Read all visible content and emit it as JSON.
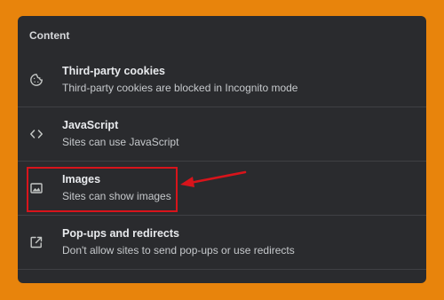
{
  "section": {
    "title": "Content"
  },
  "rows": [
    {
      "icon": "cookie-icon",
      "title": "Third-party cookies",
      "description": "Third-party cookies are blocked in Incognito mode"
    },
    {
      "icon": "code-icon",
      "title": "JavaScript",
      "description": "Sites can use JavaScript"
    },
    {
      "icon": "image-icon",
      "title": "Images",
      "description": "Sites can show images"
    },
    {
      "icon": "open-in-new-icon",
      "title": "Pop-ups and redirects",
      "description": "Don't allow sites to send pop-ups or use redirects"
    }
  ],
  "colors": {
    "background": "#e8840c",
    "panel": "#2a2b2e",
    "annotation": "#d8141b"
  }
}
